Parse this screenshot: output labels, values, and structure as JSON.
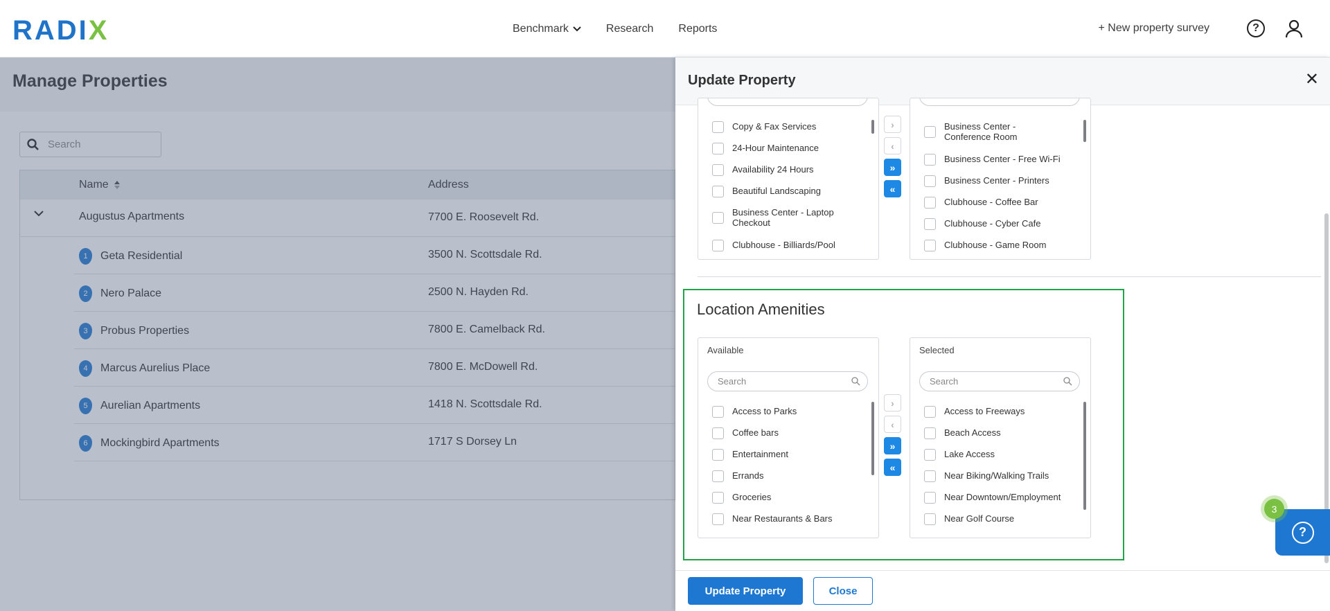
{
  "brand": {
    "logo_text_main": "RADI",
    "logo_text_accent": "X"
  },
  "nav": {
    "items": [
      {
        "label": "Benchmark",
        "has_dropdown": true
      },
      {
        "label": "Research"
      },
      {
        "label": "Reports"
      }
    ],
    "new_survey": "+ New property survey"
  },
  "page": {
    "title": "Manage Properties",
    "search_placeholder": "Search",
    "columns": {
      "name": "Name",
      "address": "Address"
    },
    "parent_row": {
      "name": "Augustus Apartments",
      "address": "7700 E. Roosevelt Rd."
    },
    "rows": [
      {
        "num": "1",
        "name": "Geta Residential",
        "address": "3500 N. Scottsdale Rd."
      },
      {
        "num": "2",
        "name": "Nero Palace",
        "address": "2500 N. Hayden Rd."
      },
      {
        "num": "3",
        "name": "Probus Properties",
        "address": "7800 E. Camelback Rd."
      },
      {
        "num": "4",
        "name": "Marcus Aurelius Place",
        "address": "7800 E. McDowell Rd."
      },
      {
        "num": "5",
        "name": "Aurelian Apartments",
        "address": "1418 N. Scottsdale Rd."
      },
      {
        "num": "6",
        "name": "Mockingbird Apartments",
        "address": "1717 S Dorsey Ln"
      }
    ]
  },
  "drawer": {
    "title": "Update Property",
    "community": {
      "available": [
        "Copy & Fax Services",
        "24-Hour Maintenance",
        "Availability 24 Hours",
        "Beautiful Landscaping",
        "Business Center - Laptop Checkout",
        "Clubhouse - Billiards/Pool"
      ],
      "selected": [
        "Business Center - Conference Room",
        "Business Center - Free Wi-Fi",
        "Business Center - Printers",
        "Clubhouse - Coffee Bar",
        "Clubhouse - Cyber Cafe",
        "Clubhouse - Game Room"
      ]
    },
    "location": {
      "title": "Location Amenities",
      "available_label": "Available",
      "selected_label": "Selected",
      "search_placeholder": "Search",
      "available": [
        "Access to Parks",
        "Coffee bars",
        "Entertainment",
        "Errands",
        "Groceries",
        "Near Restaurants & Bars"
      ],
      "selected": [
        "Access to Freeways",
        "Beach Access",
        "Lake Access",
        "Near Biking/Walking Trails",
        "Near Downtown/Employment",
        "Near Golf Course"
      ]
    },
    "buttons": {
      "update": "Update Property",
      "close": "Close"
    }
  },
  "help": {
    "badge": "3"
  },
  "colors": {
    "primary": "#1e78d2",
    "accent": "#7ac143",
    "highlight_border": "#22a34a"
  }
}
